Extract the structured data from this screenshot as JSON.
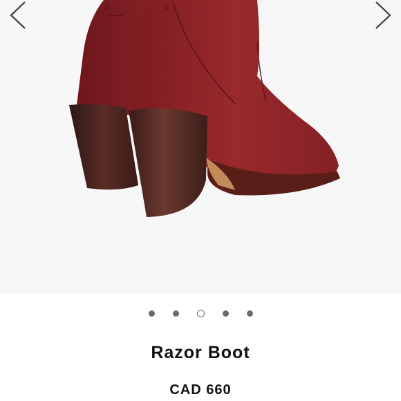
{
  "product": {
    "name": "Razor Boot",
    "price": "CAD 660"
  },
  "gallery": {
    "image_subject": "burgundy leather ankle boot",
    "total_images": 5,
    "active_index": 2,
    "prev_icon": "chevron-left-icon",
    "next_icon": "chevron-right-icon"
  },
  "colors": {
    "leather": "#8b2025",
    "heel": "#4a2420",
    "gallery_background": "#f7f7f8",
    "dot": "#6b6b6b",
    "text": "#111111"
  }
}
